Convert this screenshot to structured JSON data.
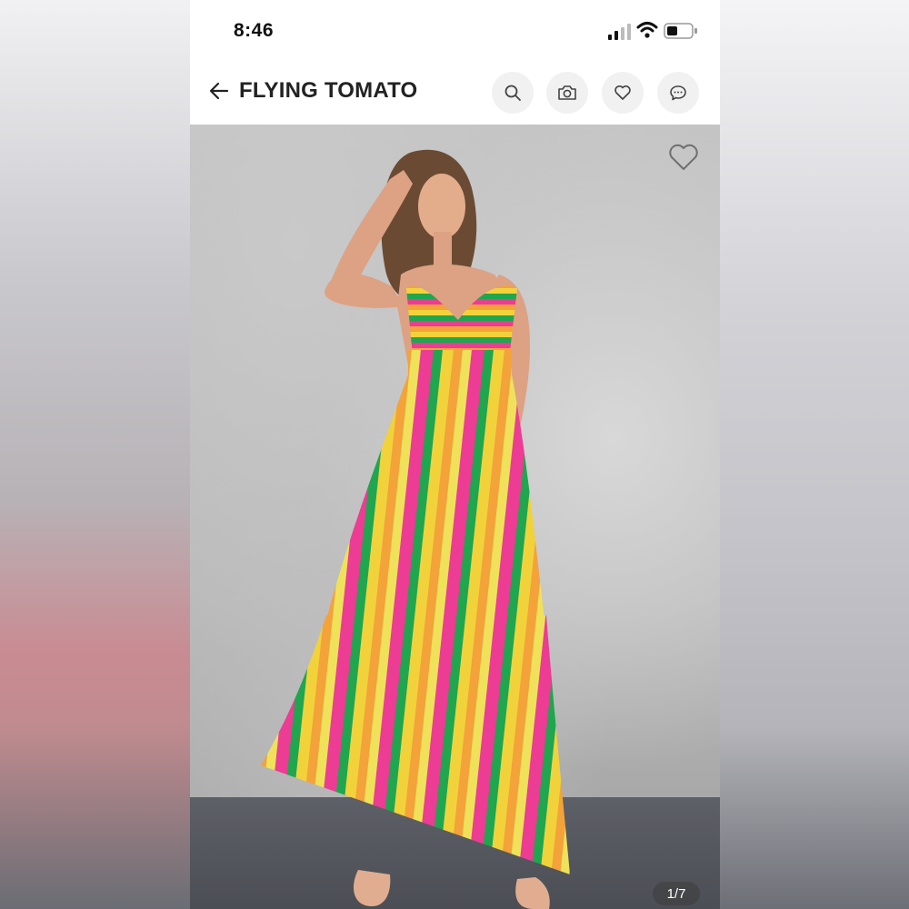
{
  "status_bar": {
    "time": "8:46"
  },
  "nav": {
    "back_icon": "arrow-left-icon",
    "title": "FLYING TOMATO",
    "buttons": [
      {
        "name": "search-icon"
      },
      {
        "name": "camera-icon"
      },
      {
        "name": "heart-icon"
      },
      {
        "name": "chat-icon"
      }
    ]
  },
  "product_image": {
    "favorite_icon": "heart-outline-icon",
    "counter": "1/7"
  },
  "colors": {
    "stripe_pink": "#ec3c93",
    "stripe_green": "#1fa64e",
    "stripe_yellow": "#f2d23a",
    "stripe_orange": "#f4a23a"
  }
}
